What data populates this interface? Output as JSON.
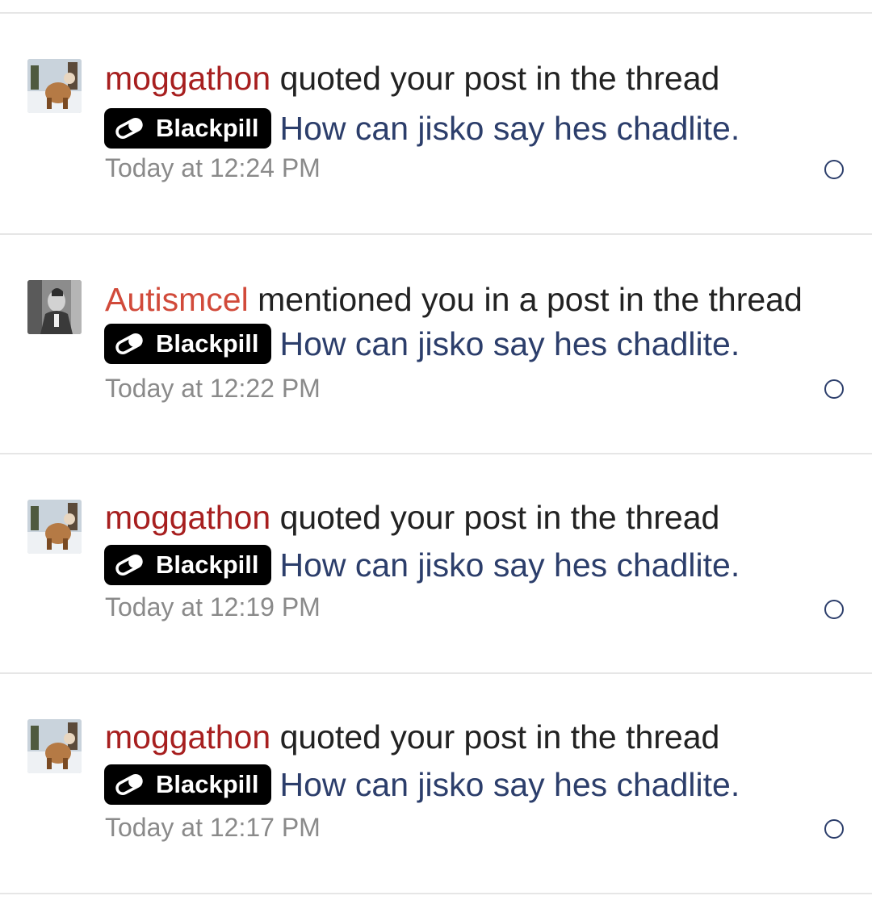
{
  "notifications": [
    {
      "username": "moggathon",
      "action": " quoted your post in the thread",
      "prefix": "Blackpill",
      "thread_title": "How can jisko say hes chadlite.",
      "time": "Today at 12:24 PM",
      "avatar": "moggathon-avatar",
      "username_color": "#a71f1f"
    },
    {
      "username": "Autismcel",
      "action": " mentioned you in a post in the thread",
      "prefix": "Blackpill",
      "thread_title": "How can jisko say hes chadlite.",
      "time": "Today at 12:22 PM",
      "avatar": "autismcel-avatar",
      "username_color": "#d14a3a"
    },
    {
      "username": "moggathon",
      "action": " quoted your post in the thread",
      "prefix": "Blackpill",
      "thread_title": "How can jisko say hes chadlite.",
      "time": "Today at 12:19 PM",
      "avatar": "moggathon-avatar",
      "username_color": "#a71f1f"
    },
    {
      "username": "moggathon",
      "action": " quoted your post in the thread",
      "prefix": "Blackpill",
      "thread_title": "How can jisko say hes chadlite.",
      "time": "Today at 12:17 PM",
      "avatar": "moggathon-avatar",
      "username_color": "#a71f1f"
    }
  ],
  "icons": {
    "prefix_icon": "pill-icon",
    "mark_read_icon": "unread-circle-icon"
  },
  "colors": {
    "thread_link": "#2c3e6b",
    "timestamp": "#8a8a8a",
    "prefix_bg": "#000000"
  }
}
